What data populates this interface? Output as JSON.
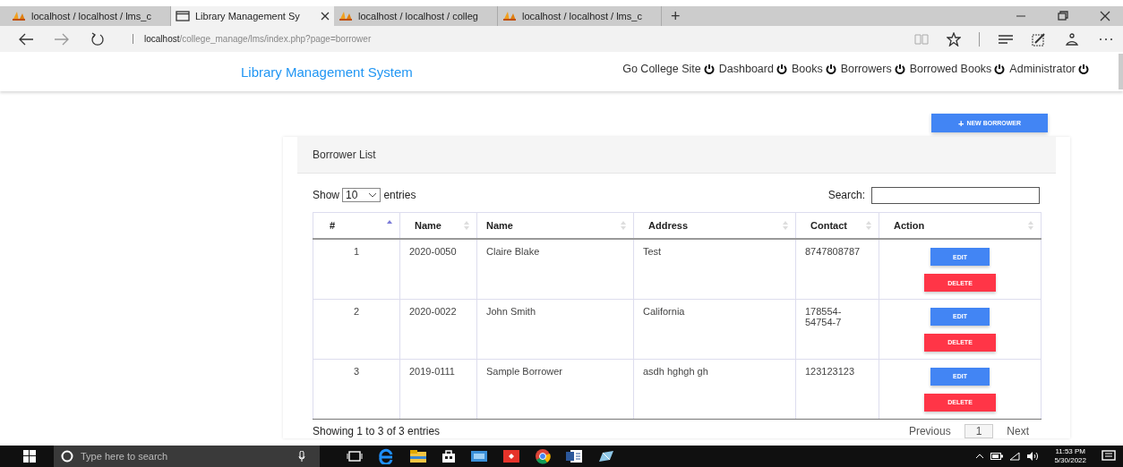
{
  "browser_tabs": [
    {
      "title": "localhost / localhost / lms_c",
      "kind": "site",
      "selected": false
    },
    {
      "title": "Library Management Sy",
      "kind": "page",
      "selected": true
    },
    {
      "title": "localhost / localhost / colleg",
      "kind": "site",
      "selected": false
    },
    {
      "title": "localhost / localhost / lms_c",
      "kind": "site",
      "selected": false
    }
  ],
  "new_tab": "+",
  "address_bar": {
    "host": "localhost",
    "path": "/college_manage/lms/index.php?page=borrower"
  },
  "navbar": {
    "brand": "Library Management System",
    "links": [
      "Go College Site",
      "Dashboard",
      "Books",
      "Borrowers",
      "Borrowed Books",
      "Administrator"
    ]
  },
  "new_button": {
    "icon": "+",
    "label": "NEW BORROWER"
  },
  "card": {
    "title": "Borrower List"
  },
  "length_menu": {
    "before": "Show",
    "value": "10",
    "after": "entries"
  },
  "search": {
    "label": "Search:"
  },
  "table": {
    "columns": [
      {
        "label": "#",
        "sorted": true
      },
      {
        "label": "Name",
        "sorted": false
      },
      {
        "label": "Name",
        "sorted": false
      },
      {
        "label": "Address",
        "sorted": false
      },
      {
        "label": "Contact",
        "sorted": false
      },
      {
        "label": "Action",
        "sorted": false
      }
    ],
    "rows": [
      {
        "cells": [
          "1",
          "2020-0050",
          "Claire Blake",
          "Test",
          "8747808787"
        ],
        "actions": [
          "EDIT",
          "DELETE"
        ]
      },
      {
        "cells": [
          "2",
          "2020-0022",
          "John Smith",
          "California",
          "178554-54754-7"
        ],
        "actions": [
          "EDIT",
          "DELETE"
        ]
      },
      {
        "cells": [
          "3",
          "2019-0111",
          "Sample Borrower",
          "asdh hghgh gh",
          "123123123"
        ],
        "actions": [
          "EDIT",
          "DELETE"
        ]
      }
    ]
  },
  "table_info": "Showing 1 to 3 of 3 entries",
  "pagination": [
    {
      "label": "Previous",
      "selected": false
    },
    {
      "label": "1",
      "selected": true
    },
    {
      "label": "Next",
      "selected": false
    }
  ],
  "taskbar": {
    "search_placeholder": "Type here to search",
    "time": "11:53 PM",
    "date": "5/30/2022"
  }
}
